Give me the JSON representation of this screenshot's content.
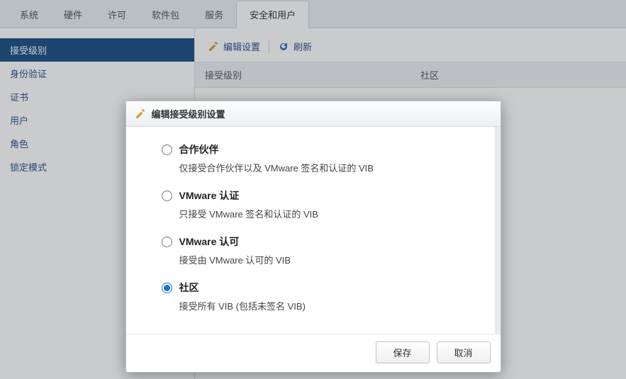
{
  "tabs": [
    {
      "label": "系统"
    },
    {
      "label": "硬件"
    },
    {
      "label": "许可"
    },
    {
      "label": "软件包"
    },
    {
      "label": "服务"
    },
    {
      "label": "安全和用户",
      "active": true
    }
  ],
  "sidebar": {
    "items": [
      {
        "label": "接受级别",
        "active": true
      },
      {
        "label": "身份验证"
      },
      {
        "label": "证书"
      },
      {
        "label": "用户"
      },
      {
        "label": "角色"
      },
      {
        "label": "锁定模式"
      }
    ]
  },
  "toolbar": {
    "edit_label": "编辑设置",
    "refresh_label": "刷新"
  },
  "kv": {
    "key_label": "接受级别",
    "value_label": "社区"
  },
  "dialog": {
    "title": "编辑接受级别设置",
    "options": [
      {
        "title": "合作伙伴",
        "desc": "仅接受合作伙伴以及 VMware 签名和认证的 VIB"
      },
      {
        "title": "VMware 认证",
        "desc": "只接受 VMware 签名和认证的 VIB"
      },
      {
        "title": "VMware 认可",
        "desc": "接受由 VMware 认可的 VIB"
      },
      {
        "title": "社区",
        "desc": "接受所有 VIB (包括未签名 VIB)",
        "selected": true
      }
    ],
    "save_label": "保存",
    "cancel_label": "取消"
  },
  "colors": {
    "accent": "#1d6fd6",
    "sidebar_active": "#194d83"
  }
}
